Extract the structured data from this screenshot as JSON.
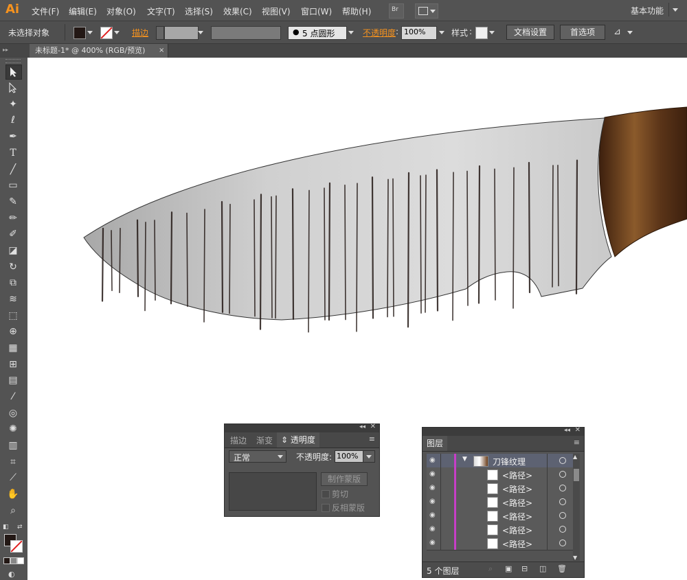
{
  "app": {
    "logo": "Ai"
  },
  "menu": {
    "items": [
      "文件(F)",
      "编辑(E)",
      "对象(O)",
      "文字(T)",
      "选择(S)",
      "效果(C)",
      "视图(V)",
      "窗口(W)",
      "帮助(H)"
    ],
    "bridge_label": "Br",
    "workspace": "基本功能"
  },
  "control": {
    "no_selection": "未选择对象",
    "stroke_label": "描边",
    "brush_label": "5 点圆形",
    "opacity_label": "不透明度",
    "opacity_value": "100%",
    "style_label": "样式",
    "doc_setup": "文档设置",
    "preferences": "首选项"
  },
  "tab": {
    "title": "未标题-1* @ 400% (RGB/预览)",
    "close": "×"
  },
  "transparency_panel": {
    "tabs": [
      "描边",
      "渐变",
      "透明度"
    ],
    "blend_mode": "正常",
    "opacity_label": "不透明度:",
    "opacity_value": "100%",
    "make_mask": "制作蒙版",
    "clip": "剪切",
    "invert_mask": "反相蒙版"
  },
  "layers_panel": {
    "title": "图层",
    "layers": [
      {
        "name": "刀锋纹理",
        "type": "layer"
      },
      {
        "name": "<路径>",
        "type": "path"
      },
      {
        "name": "<路径>",
        "type": "path"
      },
      {
        "name": "<路径>",
        "type": "path"
      },
      {
        "name": "<路径>",
        "type": "path"
      },
      {
        "name": "<路径>",
        "type": "path"
      },
      {
        "name": "<路径>",
        "type": "path"
      }
    ],
    "footer_count": "5 个图层"
  },
  "colors": {
    "accent_orange": "#f7931e",
    "layer_color": "#c73ec7",
    "handle_dark": "#4a2a14",
    "handle_light": "#8b5a2b"
  }
}
